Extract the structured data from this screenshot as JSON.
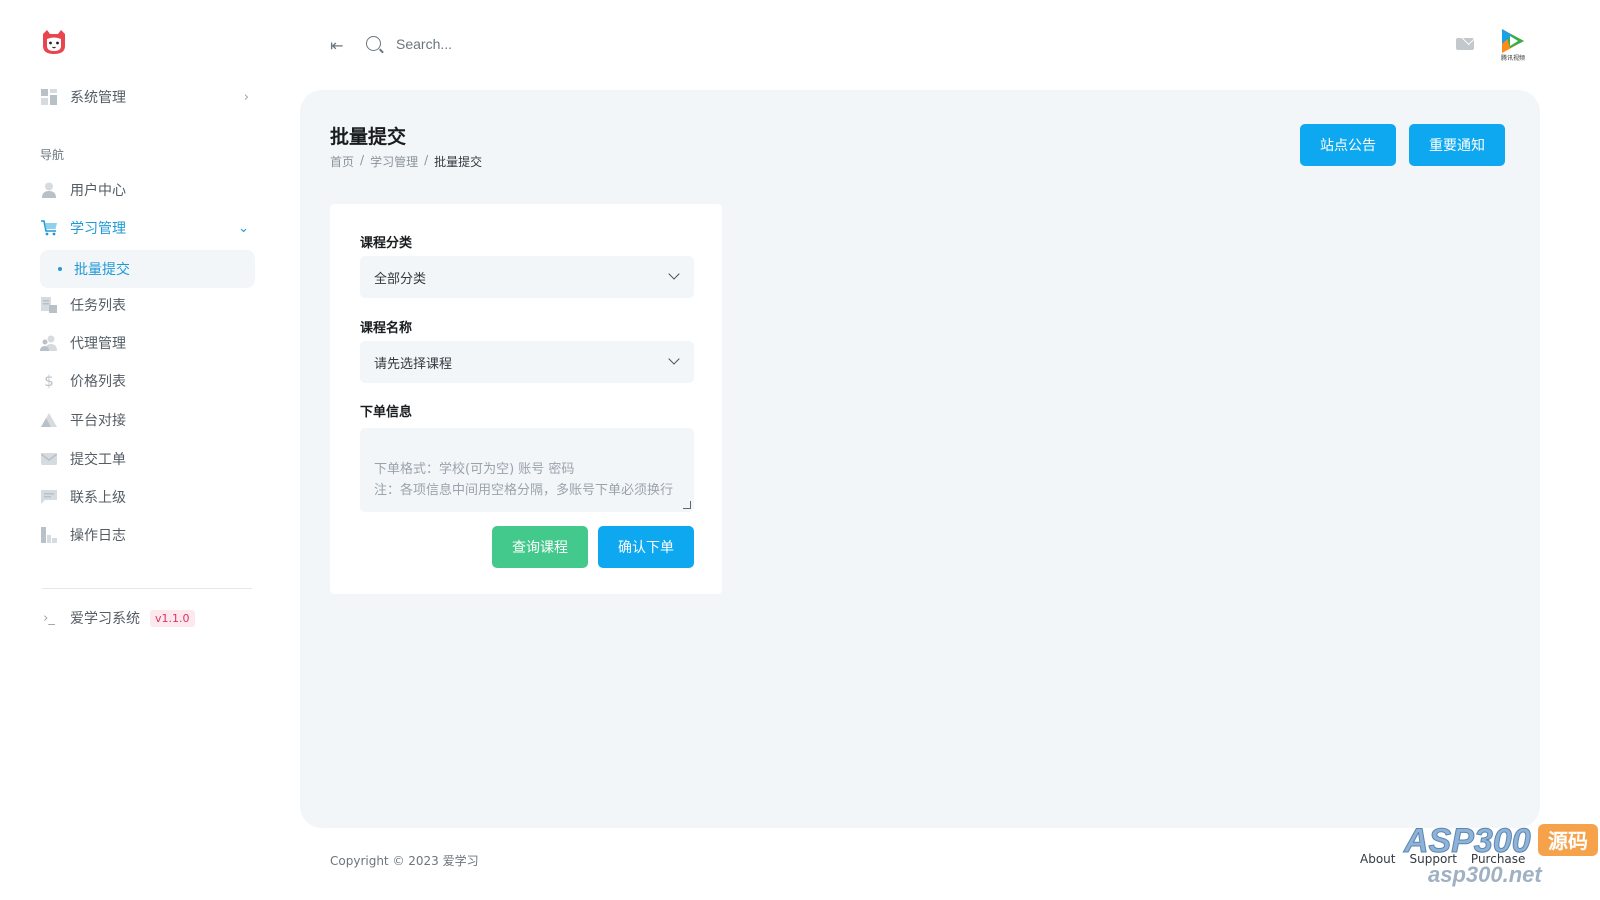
{
  "sidebar": {
    "top_item": {
      "label": "系统管理",
      "icon": "grid-icon"
    },
    "heading": "导航",
    "items": [
      {
        "label": "用户中心",
        "icon": "user-icon"
      },
      {
        "label": "学习管理",
        "icon": "cart-icon"
      },
      {
        "label": "任务列表",
        "icon": "list-icon"
      },
      {
        "label": "代理管理",
        "icon": "users-icon"
      },
      {
        "label": "价格列表",
        "icon": "dollar-icon"
      },
      {
        "label": "平台对接",
        "icon": "triangle-icon"
      },
      {
        "label": "提交工单",
        "icon": "mail-icon"
      },
      {
        "label": "联系上级",
        "icon": "chat-icon"
      },
      {
        "label": "操作日志",
        "icon": "chart-icon"
      }
    ],
    "active_sub": "批量提交",
    "footer_item": {
      "label": "爱学习系统",
      "version": "v1.1.0",
      "icon": "terminal-icon"
    },
    "accent_color": "#1f9ad6"
  },
  "topbar": {
    "search_placeholder": "Search...",
    "avatar_caption": "腾讯视频"
  },
  "page": {
    "title": "批量提交",
    "breadcrumb": [
      "首页",
      "学习管理",
      "批量提交"
    ],
    "buttons": {
      "announcement": "站点公告",
      "notice": "重要通知"
    }
  },
  "form": {
    "category_label": "课程分类",
    "category_value": "全部分类",
    "course_label": "课程名称",
    "course_value": "请先选择课程",
    "order_label": "下单信息",
    "order_placeholder": "下单格式：学校(可为空) 账号 密码\n注：各项信息中间用空格分隔，多账号下单必须换行",
    "query_button": "查询课程",
    "confirm_button": "确认下单"
  },
  "footer": {
    "copyright": "Copyright © 2023 爱学习",
    "links": [
      "About",
      "Support",
      "Purchase"
    ]
  },
  "watermark": {
    "brand": "ASP300",
    "suffix": "源码",
    "domain": "asp300.net"
  }
}
